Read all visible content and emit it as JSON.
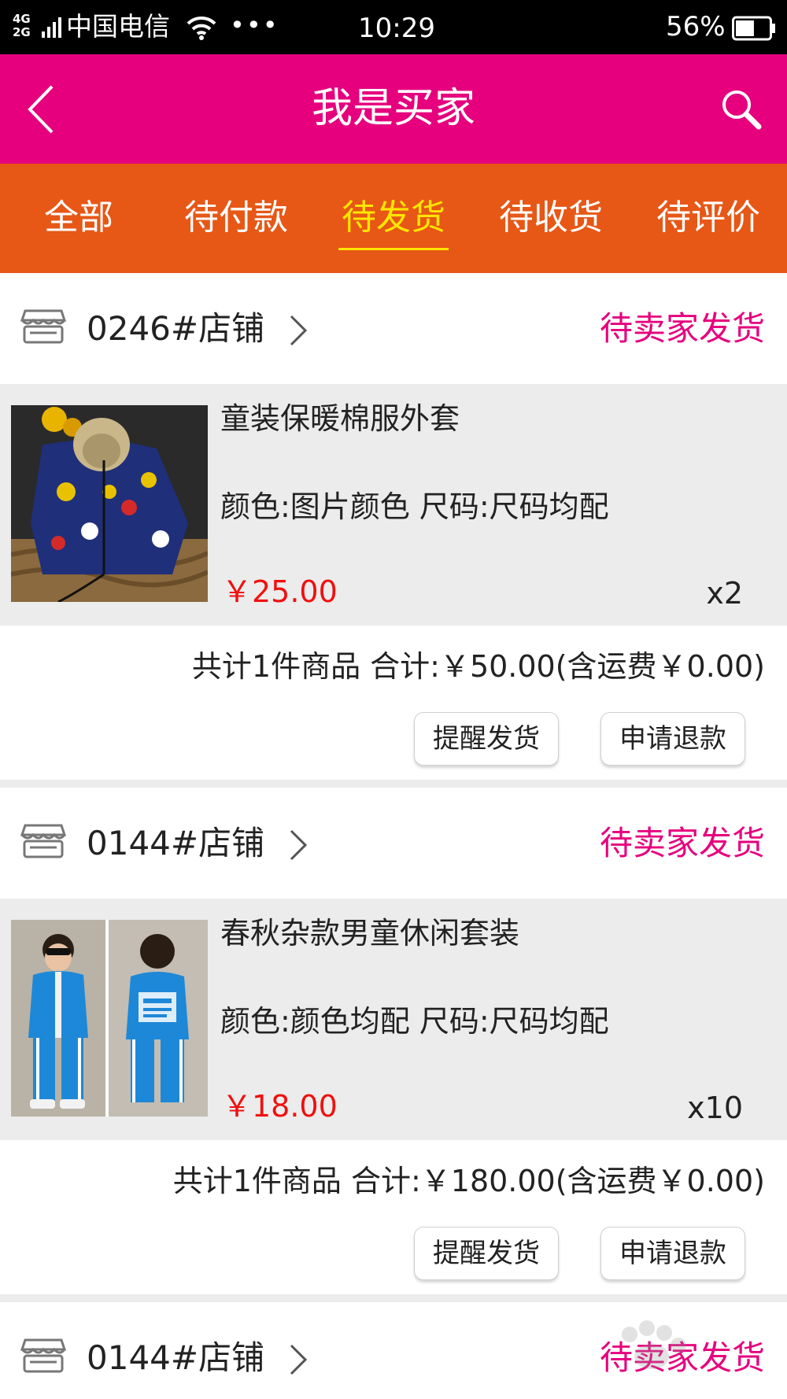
{
  "status_bar": {
    "network": "4G\n2G",
    "carrier": "中国电信",
    "more": "•••",
    "time": "10:29",
    "battery": "56%",
    "battery_level": 0.56
  },
  "header": {
    "title": "我是买家",
    "back_icon": "chevron-left-icon",
    "search_icon": "search-icon"
  },
  "tabs": [
    {
      "label": "全部",
      "active": false
    },
    {
      "label": "待付款",
      "active": false
    },
    {
      "label": "待发货",
      "active": true
    },
    {
      "label": "待收货",
      "active": false
    },
    {
      "label": "待评价",
      "active": false
    }
  ],
  "orders": [
    {
      "shop": "0246#店铺",
      "status": "待卖家发货",
      "product": {
        "name": "童装保暖棉服外套",
        "spec": "颜色:图片颜色 尺码:尺码均配",
        "price": "￥25.00",
        "qty": "x2"
      },
      "total": "共计1件商品 合计:￥50.00(含运费￥0.00)",
      "buttons": {
        "remind": "提醒发货",
        "refund": "申请退款"
      }
    },
    {
      "shop": "0144#店铺",
      "status": "待卖家发货",
      "product": {
        "name": "春秋杂款男童休闲套装",
        "spec": "颜色:颜色均配 尺码:尺码均配",
        "price": "￥18.00",
        "qty": "x10"
      },
      "total": "共计1件商品 合计:￥180.00(含运费￥0.00)",
      "buttons": {
        "remind": "提醒发货",
        "refund": "申请退款"
      }
    },
    {
      "shop": "0144#店铺",
      "status": "待卖家发货"
    }
  ],
  "colors": {
    "header": "#e6007e",
    "tabs": "#e75716",
    "active_tab": "#ffe600",
    "status_text": "#e6007e",
    "price": "#f0100f"
  }
}
